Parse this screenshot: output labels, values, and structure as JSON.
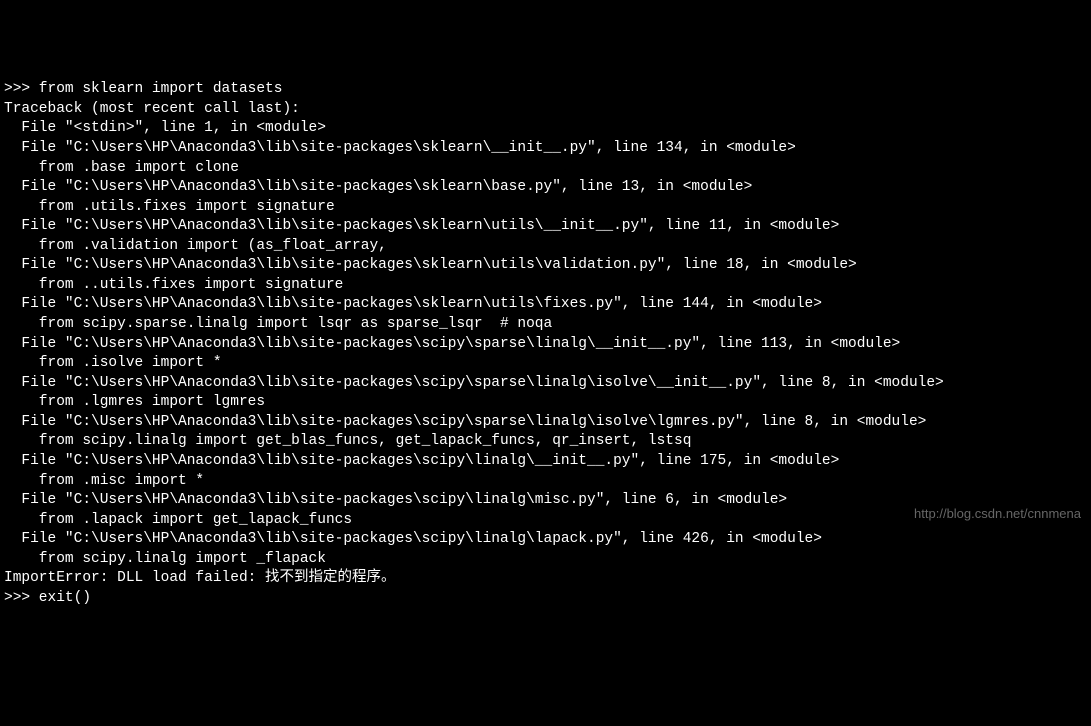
{
  "terminal": {
    "lines": [
      ">>> from sklearn import datasets",
      "Traceback (most recent call last):",
      "  File \"<stdin>\", line 1, in <module>",
      "  File \"C:\\Users\\HP\\Anaconda3\\lib\\site-packages\\sklearn\\__init__.py\", line 134, in <module>",
      "    from .base import clone",
      "  File \"C:\\Users\\HP\\Anaconda3\\lib\\site-packages\\sklearn\\base.py\", line 13, in <module>",
      "    from .utils.fixes import signature",
      "  File \"C:\\Users\\HP\\Anaconda3\\lib\\site-packages\\sklearn\\utils\\__init__.py\", line 11, in <module>",
      "    from .validation import (as_float_array,",
      "  File \"C:\\Users\\HP\\Anaconda3\\lib\\site-packages\\sklearn\\utils\\validation.py\", line 18, in <module>",
      "    from ..utils.fixes import signature",
      "  File \"C:\\Users\\HP\\Anaconda3\\lib\\site-packages\\sklearn\\utils\\fixes.py\", line 144, in <module>",
      "    from scipy.sparse.linalg import lsqr as sparse_lsqr  # noqa",
      "  File \"C:\\Users\\HP\\Anaconda3\\lib\\site-packages\\scipy\\sparse\\linalg\\__init__.py\", line 113, in <module>",
      "    from .isolve import *",
      "  File \"C:\\Users\\HP\\Anaconda3\\lib\\site-packages\\scipy\\sparse\\linalg\\isolve\\__init__.py\", line 8, in <module>",
      "    from .lgmres import lgmres",
      "  File \"C:\\Users\\HP\\Anaconda3\\lib\\site-packages\\scipy\\sparse\\linalg\\isolve\\lgmres.py\", line 8, in <module>",
      "    from scipy.linalg import get_blas_funcs, get_lapack_funcs, qr_insert, lstsq",
      "  File \"C:\\Users\\HP\\Anaconda3\\lib\\site-packages\\scipy\\linalg\\__init__.py\", line 175, in <module>",
      "    from .misc import *",
      "  File \"C:\\Users\\HP\\Anaconda3\\lib\\site-packages\\scipy\\linalg\\misc.py\", line 6, in <module>",
      "    from .lapack import get_lapack_funcs",
      "  File \"C:\\Users\\HP\\Anaconda3\\lib\\site-packages\\scipy\\linalg\\lapack.py\", line 426, in <module>",
      "    from scipy.linalg import _flapack",
      "ImportError: DLL load failed: 找不到指定的程序。",
      ">>> exit()"
    ]
  },
  "watermark": {
    "text": "http://blog.csdn.net/cnnmena"
  }
}
